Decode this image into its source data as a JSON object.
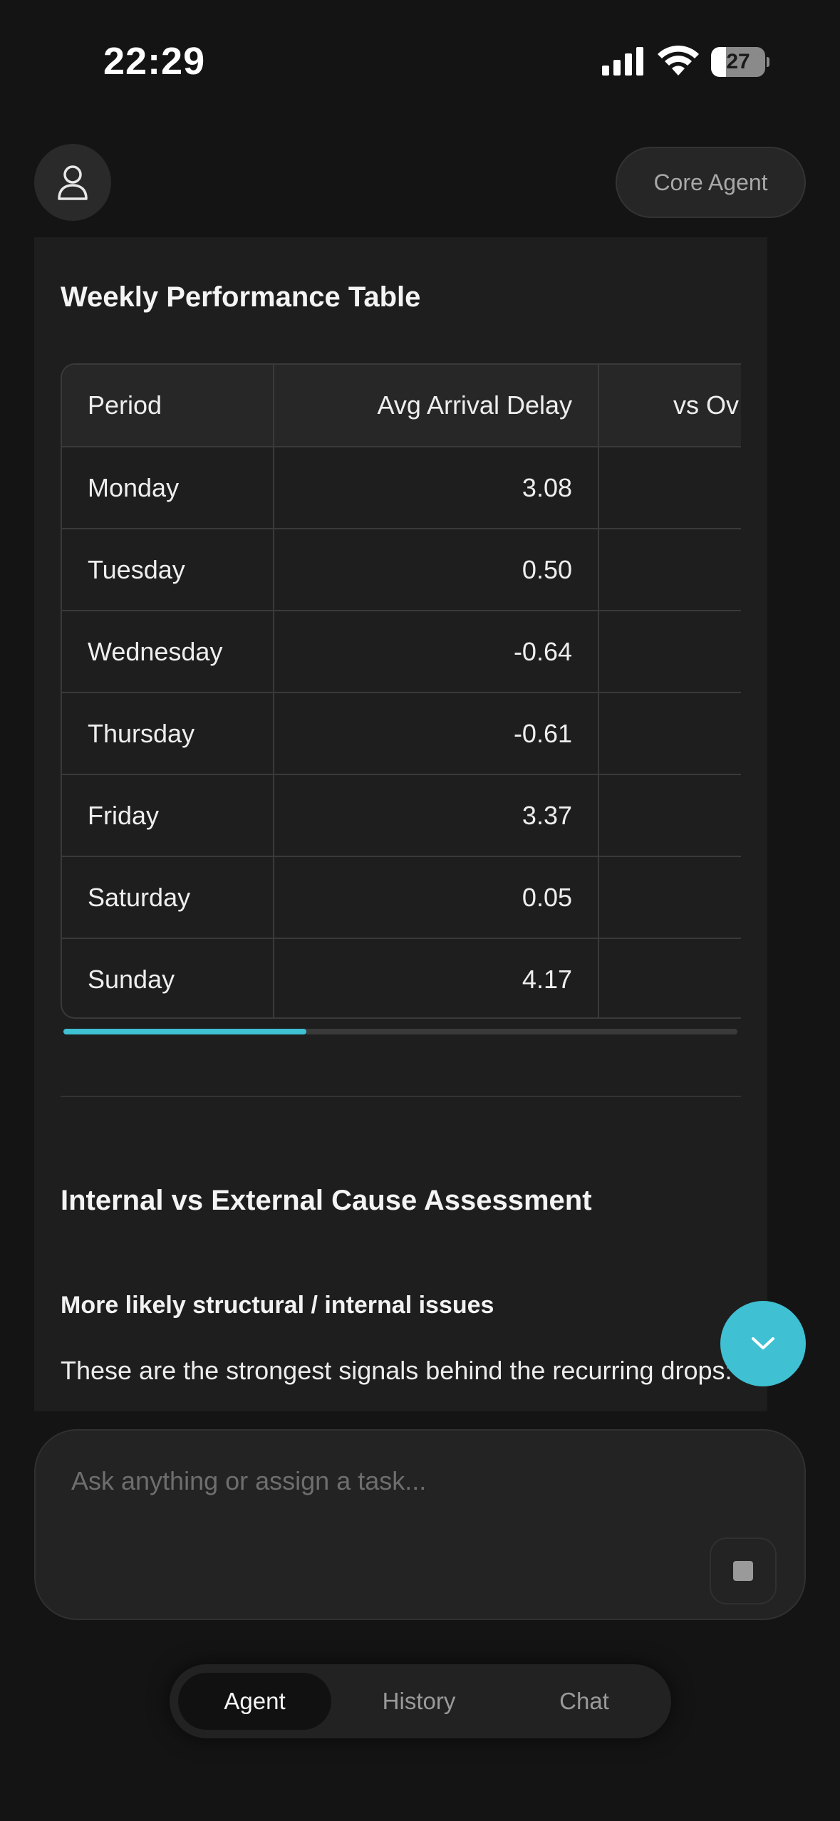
{
  "status_bar": {
    "time": "22:29",
    "battery": "27",
    "battery_level": 0.27
  },
  "header": {
    "avatar_icon": "person-icon",
    "agent_label": "Core Agent"
  },
  "message": {
    "table_title": "Weekly Performance Table",
    "table": {
      "headers": [
        "Period",
        "Avg Arrival Delay",
        "vs Ov"
      ],
      "rows": [
        {
          "period": "Monday",
          "delay": "3.08",
          "vs": "+"
        },
        {
          "period": "Tuesday",
          "delay": "0.50",
          "vs": "-"
        },
        {
          "period": "Wednesday",
          "delay": "-0.64",
          "vs": "-"
        },
        {
          "period": "Thursday",
          "delay": "-0.61",
          "vs": "-"
        },
        {
          "period": "Friday",
          "delay": "3.37",
          "vs": "+"
        },
        {
          "period": "Saturday",
          "delay": "0.05",
          "vs": "-"
        },
        {
          "period": "Sunday",
          "delay": "4.17",
          "vs": "+:"
        }
      ],
      "scroll_position": 0.36
    },
    "section_title": "Internal vs External Cause Assessment",
    "subheading": "More likely structural / internal issues",
    "paragraph": "These are the strongest signals behind the recurring drops:"
  },
  "fab_icon": "chevron-down-icon",
  "composer": {
    "placeholder": "Ask anything or assign a task...",
    "stop_icon": "stop-icon"
  },
  "tabs": [
    {
      "label": "Agent",
      "active": true
    },
    {
      "label": "History",
      "active": false
    },
    {
      "label": "Chat",
      "active": false
    }
  ],
  "colors": {
    "accent": "#3fc0d3",
    "background": "#141414",
    "card": "#1e1e1e"
  }
}
